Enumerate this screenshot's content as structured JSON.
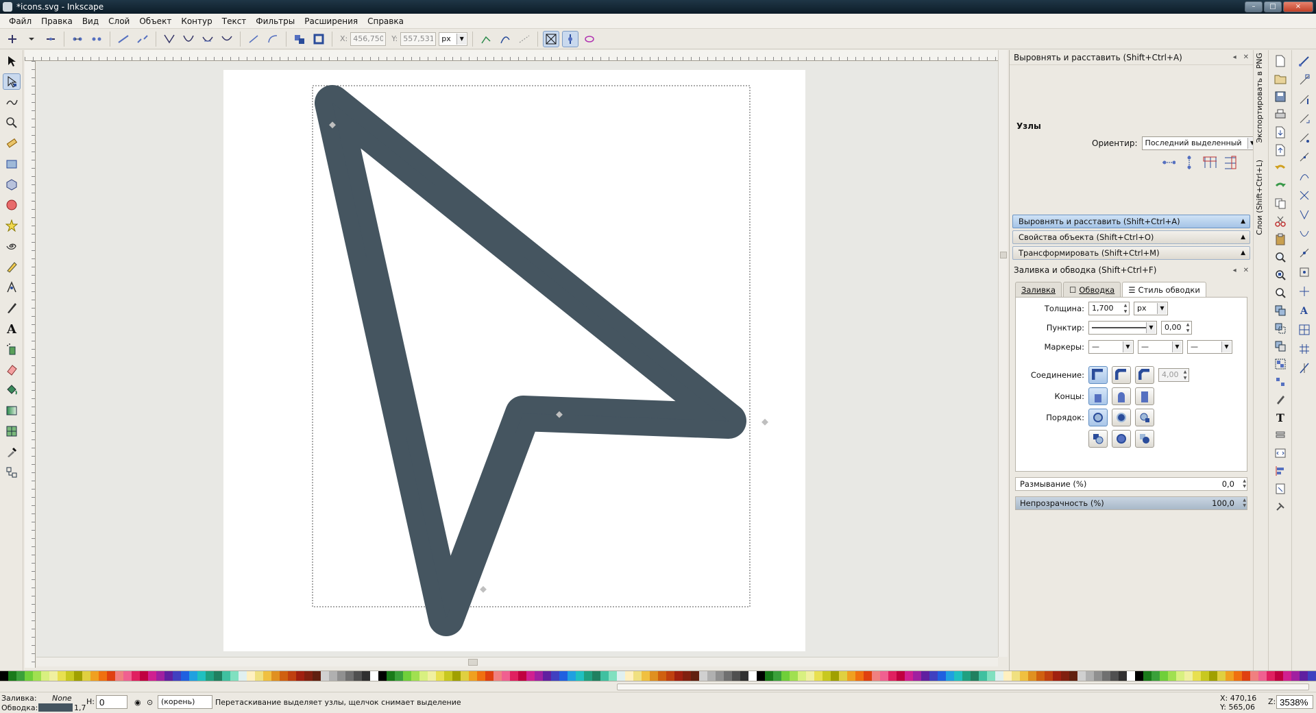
{
  "window": {
    "title": "*icons.svg - Inkscape",
    "controls": [
      "–",
      "□",
      "×"
    ]
  },
  "menu": [
    "Файл",
    "Правка",
    "Вид",
    "Слой",
    "Объект",
    "Контур",
    "Текст",
    "Фильтры",
    "Расширения",
    "Справка"
  ],
  "toolbar": {
    "x_label": "X:",
    "x_value": "456,750",
    "y_label": "Y:",
    "y_value": "557,531",
    "unit": "px"
  },
  "align_panel": {
    "title": "Выровнять и расставить (Shift+Ctrl+A)",
    "section": "Узлы",
    "relative_label": "Ориентир:",
    "relative_value": "Последний выделенный"
  },
  "collapsed_panels": [
    "Выровнять и расставить (Shift+Ctrl+A)",
    "Свойства объекта (Shift+Ctrl+O)",
    "Трансформировать (Shift+Ctrl+M)"
  ],
  "fill_stroke": {
    "title": "Заливка и обводка (Shift+Ctrl+F)",
    "tabs": {
      "fill": "Заливка",
      "stroke_paint": "Обводка",
      "stroke_style": "Стиль обводки"
    },
    "width_label": "Толщина:",
    "width_value": "1,700",
    "width_unit": "px",
    "dash_label": "Пунктир:",
    "dash_offset": "0,00",
    "markers_label": "Маркеры:",
    "join_label": "Соединение:",
    "miter_value": "4,00",
    "cap_label": "Концы:",
    "order_label": "Порядок:",
    "blur_label": "Размывание (%)",
    "blur_value": "0,0",
    "opacity_label": "Непрозрачность (%)",
    "opacity_value": "100,0"
  },
  "side_tabs": {
    "export": "Экспортировать в PNG",
    "layers": "Слои (Shift+Ctrl+L)"
  },
  "statusbar": {
    "fill_label": "Заливка:",
    "fill_value": "None",
    "stroke_label": "Обводка:",
    "stroke_width": "1,7",
    "h_label": "H:",
    "h_value": "0",
    "layer": "(корень)",
    "message": "Перетаскивание выделяет узлы, щелчок снимает выделение",
    "x": "X:   470,16",
    "y": "Y:   565,06",
    "zoom_label": "Z:",
    "zoom_value": "3538%"
  },
  "colors": {
    "stroke": "#455560",
    "accent": "#c9d9ee"
  }
}
